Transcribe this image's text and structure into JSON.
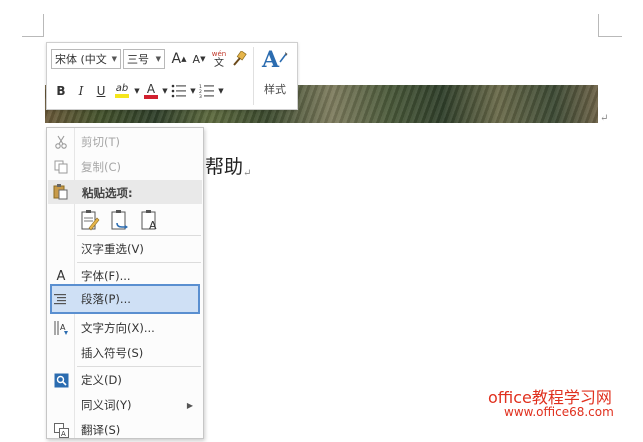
{
  "document": {
    "visible_text": "帮助",
    "paragraph_mark": "↵"
  },
  "mini_toolbar": {
    "font_name": "宋体 (中文",
    "font_size": "三号",
    "grow_font": "A",
    "shrink_font": "A",
    "phonetic_top": "wén",
    "phonetic_bottom": "文",
    "bold": "B",
    "italic": "I",
    "underline": "U",
    "highlight_letter": "ab",
    "font_color_letter": "A",
    "styles_label": "样式",
    "colors": {
      "highlight": "#f5e61b",
      "font_color": "#d2202f",
      "styles_blue": "#2b6cb0"
    }
  },
  "context_menu": {
    "items": [
      {
        "label": "剪切(T)",
        "icon": "scissors-icon",
        "enabled": false
      },
      {
        "label": "复制(C)",
        "icon": "copy-icon",
        "enabled": false
      },
      {
        "label": "粘贴选项:",
        "icon": "paste-icon",
        "enabled": true
      },
      {
        "label": "汉字重选(V)",
        "icon": "",
        "enabled": true
      },
      {
        "label": "字体(F)...",
        "icon": "font-icon",
        "enabled": true
      },
      {
        "label": "段落(P)...",
        "icon": "paragraph-icon",
        "enabled": true,
        "highlighted": true
      },
      {
        "label": "文字方向(X)...",
        "icon": "text-direction-icon",
        "enabled": true
      },
      {
        "label": "插入符号(S)",
        "icon": "",
        "enabled": true
      },
      {
        "label": "定义(D)",
        "icon": "define-icon",
        "enabled": true
      },
      {
        "label": "同义词(Y)",
        "icon": "",
        "enabled": true,
        "has_submenu": true
      },
      {
        "label": "翻译(S)",
        "icon": "translate-icon",
        "enabled": true
      }
    ],
    "paste_options": [
      "paste-keep-formatting-icon",
      "paste-merge-formatting-icon",
      "paste-text-only-icon"
    ]
  },
  "watermark": {
    "line1": "office教程学习网",
    "line2": "www.office68.com"
  }
}
